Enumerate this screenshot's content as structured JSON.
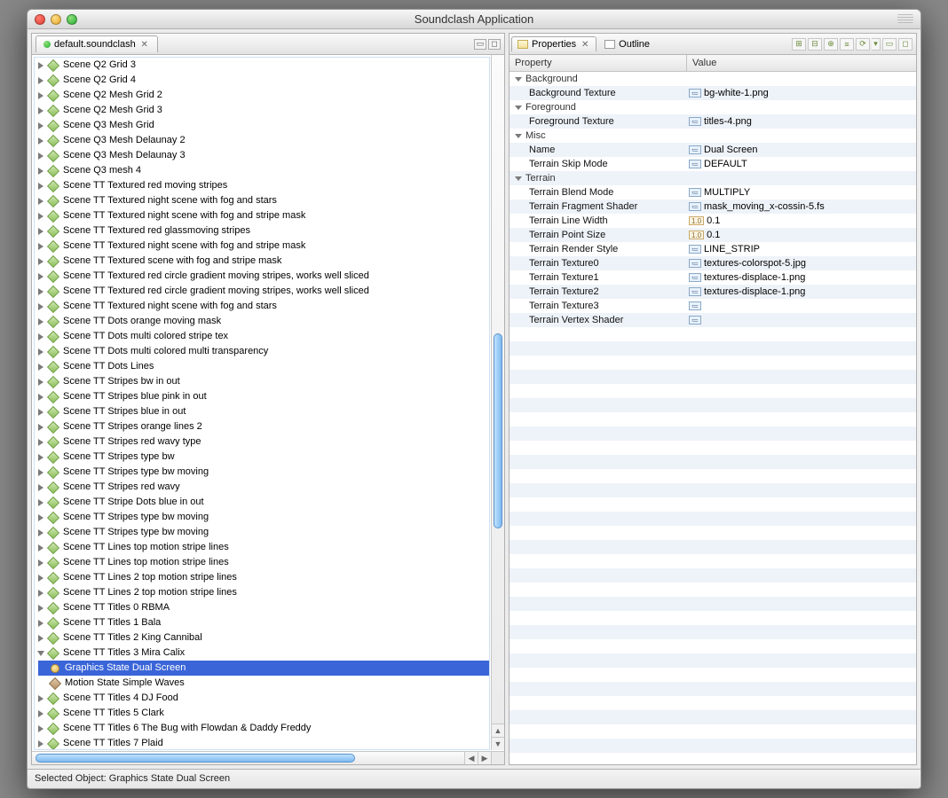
{
  "window": {
    "title": "Soundclash Application"
  },
  "editorTab": {
    "label": "default.soundclash"
  },
  "tree": {
    "items": [
      "Scene Q2 Grid 3",
      "Scene Q2 Grid 4",
      "Scene Q2 Mesh Grid 2",
      "Scene Q2 Mesh Grid 3",
      "Scene Q3 Mesh Grid",
      "Scene Q3 Mesh Delaunay 2",
      "Scene Q3 Mesh Delaunay 3",
      "Scene Q3 mesh 4",
      "Scene TT Textured red moving stripes",
      "Scene TT Textured night scene with fog and stars",
      "Scene TT Textured night scene with fog and stripe mask",
      "Scene TT Textured red glassmoving stripes",
      "Scene TT Textured night scene with fog and stripe mask",
      "Scene TT Textured scene with fog and stripe mask",
      "Scene TT Textured red circle gradient moving stripes, works well sliced",
      "Scene TT Textured red circle gradient moving stripes, works well sliced",
      "Scene TT Textured night scene with fog and stars",
      "Scene TT Dots orange moving mask",
      "Scene TT Dots multi colored stripe tex",
      "Scene TT Dots multi colored multi transparency",
      "Scene TT Dots Lines",
      "Scene TT Stripes bw in out",
      "Scene TT Stripes blue pink in out",
      "Scene TT Stripes blue in out",
      "Scene TT Stripes orange lines 2",
      "Scene TT Stripes red wavy type",
      "Scene TT Stripes type bw",
      "Scene TT Stripes type bw moving",
      "Scene TT Stripes red wavy",
      "Scene TT Stripe Dots blue in out",
      "Scene TT Stripes type bw moving",
      "Scene TT Stripes type bw moving",
      "Scene TT Lines top motion stripe lines",
      "Scene TT Lines top motion stripe lines",
      "Scene TT Lines 2 top motion stripe lines",
      "Scene TT Lines 2 top motion stripe lines",
      "Scene TT Titles 0 RBMA",
      "Scene TT Titles 1 Bala",
      "Scene TT Titles 2  King Cannibal"
    ],
    "expanded": {
      "label": "Scene TT Titles 3 Mira Calix",
      "children": [
        {
          "label": "Graphics State Dual Screen",
          "kind": "sun",
          "selected": true
        },
        {
          "label": "Motion State Simple Waves",
          "kind": "diamond-brown",
          "selected": false
        }
      ]
    },
    "itemsAfter": [
      "Scene TT Titles 4 DJ Food",
      "Scene TT Titles 5 Clark",
      "Scene TT Titles 6 The Bug with Flowdan & Daddy Freddy",
      "Scene TT Titles 7 Plaid"
    ]
  },
  "propTabs": {
    "properties": "Properties",
    "outline": "Outline"
  },
  "propHeader": {
    "property": "Property",
    "value": "Value"
  },
  "properties": [
    {
      "type": "cat",
      "label": "Background"
    },
    {
      "type": "prop",
      "label": "Background Texture",
      "tag": "txt",
      "value": "bg-white-1.png"
    },
    {
      "type": "cat",
      "label": "Foreground"
    },
    {
      "type": "prop",
      "label": "Foreground Texture",
      "tag": "txt",
      "value": "titles-4.png"
    },
    {
      "type": "cat",
      "label": "Misc"
    },
    {
      "type": "prop",
      "label": "Name",
      "tag": "txt",
      "value": "Dual Screen"
    },
    {
      "type": "prop",
      "label": "Terrain Skip Mode",
      "tag": "txt",
      "value": "DEFAULT"
    },
    {
      "type": "cat",
      "label": "Terrain"
    },
    {
      "type": "prop",
      "label": "Terrain Blend Mode",
      "tag": "txt",
      "value": "MULTIPLY"
    },
    {
      "type": "prop",
      "label": "Terrain Fragment Shader",
      "tag": "txt",
      "value": "mask_moving_x-cossin-5.fs"
    },
    {
      "type": "prop",
      "label": "Terrain Line Width",
      "tag": "num",
      "value": "0.1"
    },
    {
      "type": "prop",
      "label": "Terrain Point Size",
      "tag": "num",
      "value": "0.1"
    },
    {
      "type": "prop",
      "label": "Terrain Render Style",
      "tag": "txt",
      "value": "LINE_STRIP"
    },
    {
      "type": "prop",
      "label": "Terrain Texture0",
      "tag": "txt",
      "value": "textures-colorspot-5.jpg"
    },
    {
      "type": "prop",
      "label": "Terrain Texture1",
      "tag": "txt",
      "value": "textures-displace-1.png"
    },
    {
      "type": "prop",
      "label": "Terrain Texture2",
      "tag": "txt",
      "value": "textures-displace-1.png"
    },
    {
      "type": "prop",
      "label": "Terrain Texture3",
      "tag": "txt",
      "value": ""
    },
    {
      "type": "prop",
      "label": "Terrain Vertex Shader",
      "tag": "txt",
      "value": ""
    }
  ],
  "status": {
    "text": "Selected Object: Graphics State Dual Screen"
  }
}
